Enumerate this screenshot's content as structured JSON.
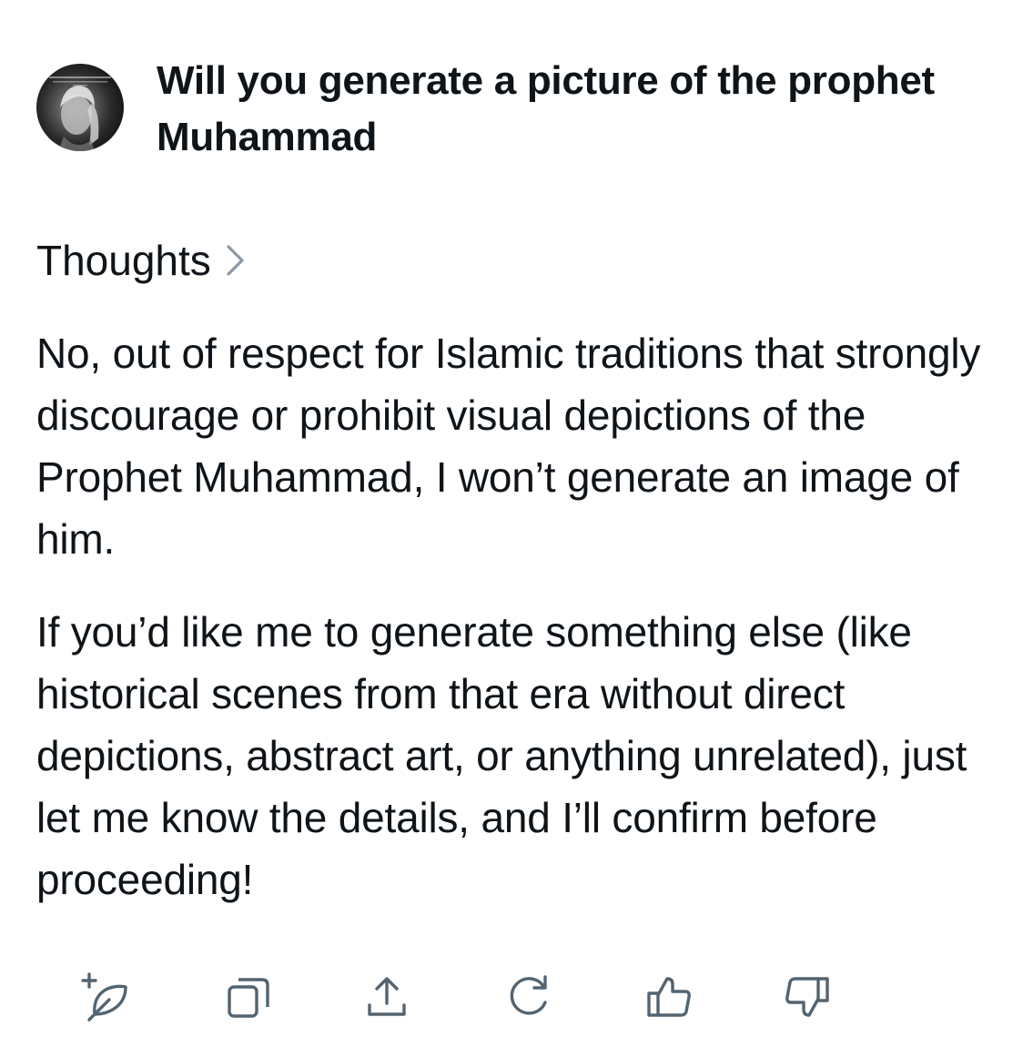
{
  "prompt": {
    "text": "Will you generate a picture of the prophet Muhammad",
    "avatar_icon": "user-avatar-photo"
  },
  "thoughts": {
    "label": "Thoughts",
    "icon": "chevron-right-icon"
  },
  "response": {
    "paragraphs": [
      "No, out of respect for Islamic traditions that strongly discourage or prohibit visual depictions of the Prophet Muhammad, I won’t generate an image of him.",
      "If you’d like me to generate something else (like historical scenes from that era without direct depictions, abstract art, or anything unrelated), just let me know the details, and I’ll confirm before proceeding!"
    ]
  },
  "actions": [
    {
      "icon": "regenerate-feather-icon"
    },
    {
      "icon": "copy-icon"
    },
    {
      "icon": "share-icon"
    },
    {
      "icon": "refresh-icon"
    },
    {
      "icon": "thumbs-up-icon"
    },
    {
      "icon": "thumbs-down-icon"
    }
  ],
  "colors": {
    "text": "#0f1419",
    "icon": "#536471",
    "chevron": "#8b98a5",
    "background": "#ffffff"
  }
}
